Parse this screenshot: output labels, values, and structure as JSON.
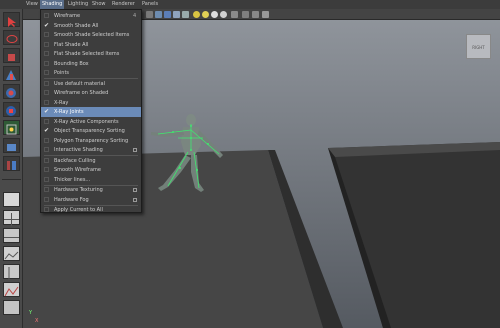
{
  "menubar": {
    "items": [
      "View",
      "Shading",
      "Lighting",
      "Show",
      "Renderer",
      "Panels"
    ]
  },
  "viewcube": {
    "label": "RIGHT"
  },
  "shading_menu": {
    "items": [
      {
        "label": "Wireframe",
        "checked": false,
        "option": false,
        "arrow": "4"
      },
      {
        "label": "Smooth Shade All",
        "checked": true,
        "option": false
      },
      {
        "label": "Smooth Shade Selected Items",
        "checked": false,
        "option": false
      },
      {
        "label": "Flat Shade All",
        "checked": false,
        "option": false
      },
      {
        "label": "Flat Shade Selected Items",
        "checked": false,
        "option": false
      },
      {
        "label": "Bounding Box",
        "checked": false,
        "option": false
      },
      {
        "label": "Points",
        "checked": false,
        "option": false
      },
      {
        "label": "Use default material",
        "checked": false,
        "option": false
      },
      {
        "label": "Wireframe on Shaded",
        "checked": false,
        "option": false
      },
      {
        "label": "X-Ray",
        "checked": false,
        "option": false
      },
      {
        "label": "X-Ray Joints",
        "checked": true,
        "option": false,
        "highlighted": true
      },
      {
        "label": "X-Ray Active Components",
        "checked": false,
        "option": false
      },
      {
        "label": "Object Transparency Sorting",
        "checked": true,
        "option": false
      },
      {
        "label": "Polygon Transparency Sorting",
        "checked": false,
        "option": false
      },
      {
        "label": "Interactive Shading",
        "checked": false,
        "option": true
      },
      {
        "label": "Backface Culling",
        "checked": false,
        "option": false
      },
      {
        "label": "Smooth Wireframe",
        "checked": false,
        "option": false
      },
      {
        "label": "Thicker lines...",
        "checked": false,
        "option": false
      },
      {
        "label": "Hardware Texturing",
        "checked": false,
        "option": true
      },
      {
        "label": "Hardware Fog",
        "checked": false,
        "option": true
      },
      {
        "label": "Apply Current to All",
        "checked": false,
        "option": false
      }
    ]
  },
  "axis": {
    "y": "Y",
    "x": "X"
  },
  "colors": {
    "highlight": "#6b8bb8",
    "skeleton": "#7fc9a8",
    "joint": "#3fe870",
    "ground": "#464646"
  }
}
